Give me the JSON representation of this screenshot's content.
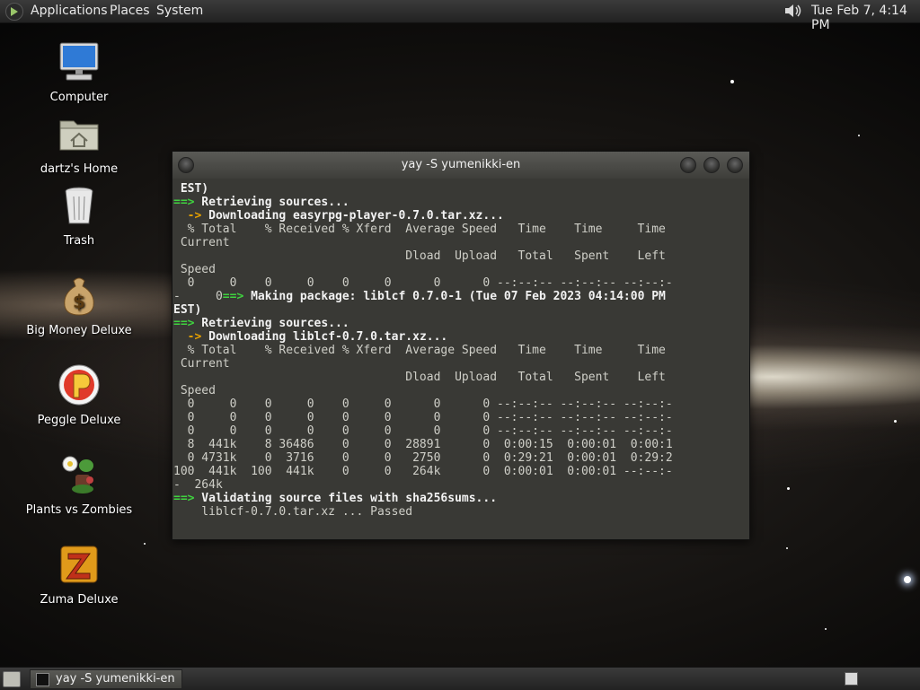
{
  "top_panel": {
    "menus": [
      "Applications",
      "Places",
      "System"
    ],
    "clock": "Tue Feb  7, 4:14 PM"
  },
  "desktop_icons": [
    {
      "label": "Computer",
      "icon": "computer-icon"
    },
    {
      "label": "dartz's Home",
      "icon": "home-folder-icon"
    },
    {
      "label": "Trash",
      "icon": "trash-icon"
    },
    {
      "label": "Big Money Deluxe",
      "icon": "money-bag-icon"
    },
    {
      "label": "Peggle Deluxe",
      "icon": "peggle-icon"
    },
    {
      "label": "Plants vs Zombies",
      "icon": "plants-vs-zombies-icon"
    },
    {
      "label": "Zuma Deluxe",
      "icon": "zuma-icon"
    }
  ],
  "window": {
    "title": "yay -S yumenikki-en",
    "terminal_lines": [
      {
        "segments": [
          {
            "text": " EST)",
            "style": "b"
          }
        ]
      },
      {
        "segments": [
          {
            "text": "==>",
            "style": "g"
          },
          {
            "text": " Retrieving sources...",
            "style": "b"
          }
        ]
      },
      {
        "segments": [
          {
            "text": "  ->",
            "style": "y"
          },
          {
            "text": " Downloading easyrpg-player-0.7.0.tar.xz...",
            "style": "b"
          }
        ]
      },
      {
        "segments": [
          {
            "text": "  % Total    % Received % Xferd  Average Speed   Time    Time     Time",
            "style": ""
          }
        ]
      },
      {
        "segments": [
          {
            "text": " Current",
            "style": ""
          }
        ]
      },
      {
        "segments": [
          {
            "text": "                                 Dload  Upload   Total   Spent    Left",
            "style": ""
          }
        ]
      },
      {
        "segments": [
          {
            "text": " Speed",
            "style": ""
          }
        ]
      },
      {
        "segments": [
          {
            "text": "  0     0    0     0    0     0      0      0 --:--:-- --:--:-- --:--:-",
            "style": ""
          }
        ]
      },
      {
        "segments": [
          {
            "text": "-     0",
            "style": ""
          },
          {
            "text": "==>",
            "style": "g"
          },
          {
            "text": " Making package: liblcf 0.7.0-1 (Tue 07 Feb 2023 04:14:00 PM",
            "style": "b"
          }
        ]
      },
      {
        "segments": [
          {
            "text": "EST)",
            "style": "b"
          }
        ]
      },
      {
        "segments": [
          {
            "text": "==>",
            "style": "g"
          },
          {
            "text": " Retrieving sources...",
            "style": "b"
          }
        ]
      },
      {
        "segments": [
          {
            "text": "  ->",
            "style": "y"
          },
          {
            "text": " Downloading liblcf-0.7.0.tar.xz...",
            "style": "b"
          }
        ]
      },
      {
        "segments": [
          {
            "text": "  % Total    % Received % Xferd  Average Speed   Time    Time     Time",
            "style": ""
          }
        ]
      },
      {
        "segments": [
          {
            "text": " Current",
            "style": ""
          }
        ]
      },
      {
        "segments": [
          {
            "text": "                                 Dload  Upload   Total   Spent    Left",
            "style": ""
          }
        ]
      },
      {
        "segments": [
          {
            "text": " Speed",
            "style": ""
          }
        ]
      },
      {
        "segments": [
          {
            "text": "  0     0    0     0    0     0      0      0 --:--:-- --:--:-- --:--:-",
            "style": ""
          }
        ]
      },
      {
        "segments": [
          {
            "text": "  0     0    0     0    0     0      0      0 --:--:-- --:--:-- --:--:-",
            "style": ""
          }
        ]
      },
      {
        "segments": [
          {
            "text": "  0     0    0     0    0     0      0      0 --:--:-- --:--:-- --:--:-",
            "style": ""
          }
        ]
      },
      {
        "segments": [
          {
            "text": "  8  441k    8 36486    0     0  28891      0  0:00:15  0:00:01  0:00:1",
            "style": ""
          }
        ]
      },
      {
        "segments": [
          {
            "text": "  0 4731k    0  3716    0     0   2750      0  0:29:21  0:00:01  0:29:2",
            "style": ""
          }
        ]
      },
      {
        "segments": [
          {
            "text": "100  441k  100  441k    0     0   264k      0  0:00:01  0:00:01 --:--:-",
            "style": ""
          }
        ]
      },
      {
        "segments": [
          {
            "text": "-  264k",
            "style": ""
          }
        ]
      },
      {
        "segments": [
          {
            "text": "==>",
            "style": "g"
          },
          {
            "text": " Validating source files with sha256sums...",
            "style": "b"
          }
        ]
      },
      {
        "segments": [
          {
            "text": "    liblcf-0.7.0.tar.xz ... Passed",
            "style": ""
          }
        ]
      }
    ]
  },
  "bottom_panel": {
    "task_label": "yay -S yumenikki-en"
  }
}
